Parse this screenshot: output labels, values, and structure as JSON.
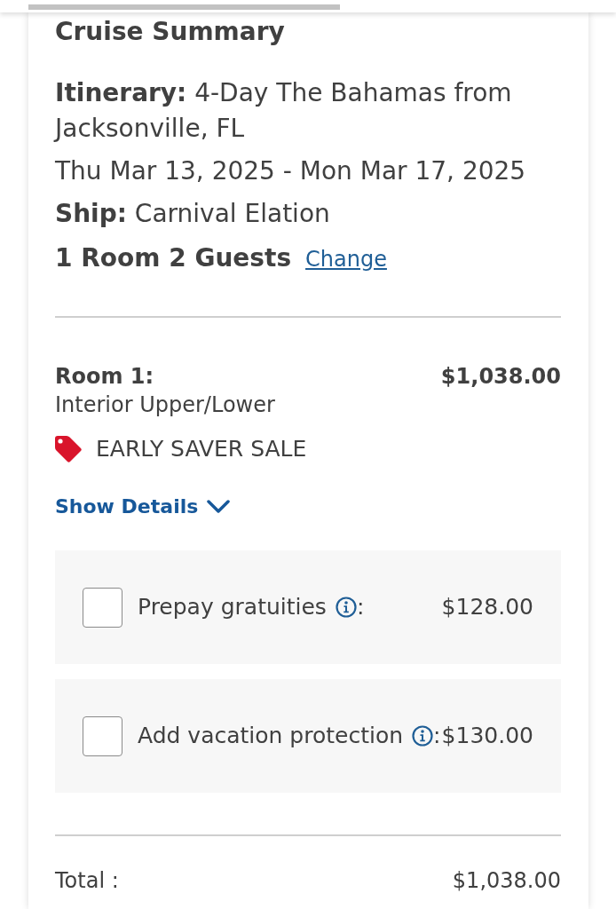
{
  "summary": {
    "title": "Cruise Summary",
    "details": [
      "**Itinerary:** 4-Day The Bahamas from Jacksonville, FL",
      "Thu Mar 13, 2025 - Mon Mar 17, 2025",
      "**Ship:** Carnival Elation"
    ],
    "occupancy": "1 Room 2 Guests",
    "change_link": "Change"
  },
  "room": {
    "title": "Room 1:",
    "price": "$1,038.00",
    "category": "Interior Upper/Lower",
    "promo": "EARLY SAVER SALE",
    "details_toggle": {
      "label": "Show Details",
      "expanded": false
    }
  },
  "add_ons": [
    {
      "label": "Prepay gratuities",
      "suffix": ":",
      "price": "$128.00",
      "checked": false
    },
    {
      "label": "Add vacation protection",
      "suffix": ":",
      "price": "$130.00",
      "checked": false
    }
  ],
  "total": {
    "label": "Total :",
    "value": "$1,038.00"
  }
}
